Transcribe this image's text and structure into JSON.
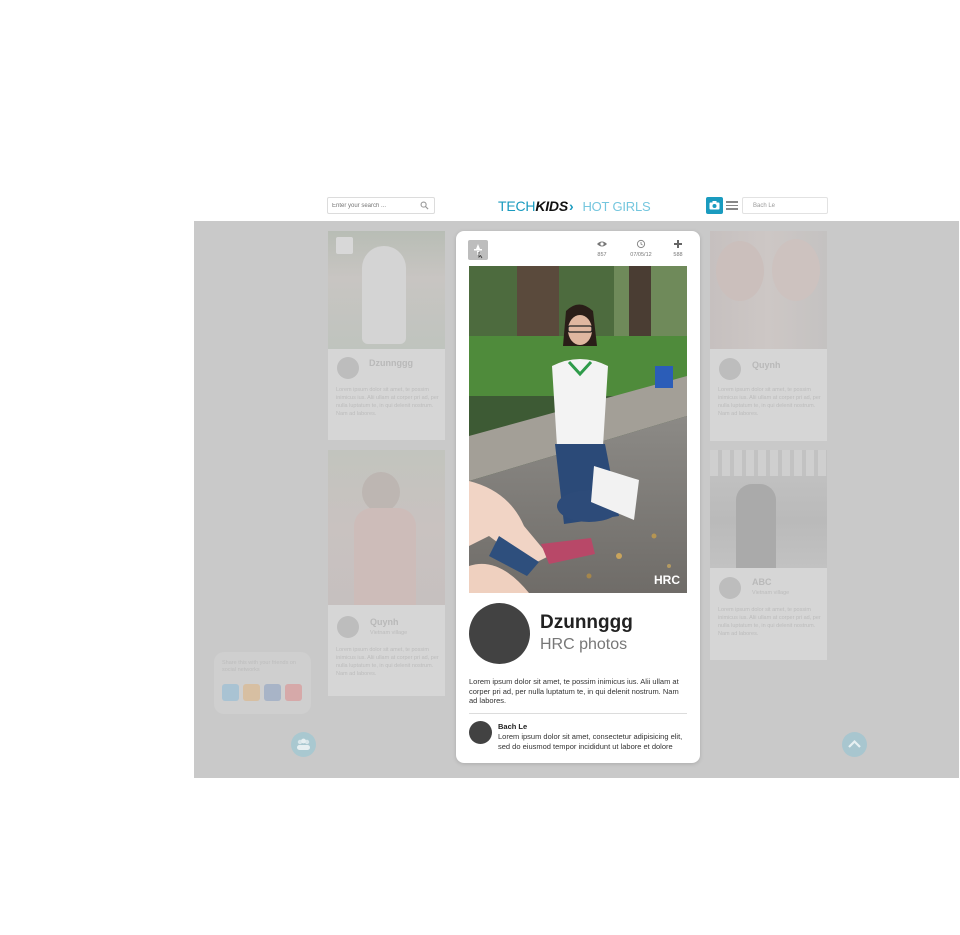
{
  "header": {
    "search_placeholder": "Enter your search ...",
    "logo": {
      "tech": "TECH",
      "kids": "KIDS",
      "chevron": "›",
      "hot": "HOT GIRLS"
    },
    "username": "Bach Le"
  },
  "background_cards": {
    "left": [
      {
        "name": "Dzunnggg",
        "text": "Lorem ipsum dolor sit amet, te possim inimicus ius. Alii ullam at corper pri ad, per nulla luptatum te, in qui delenit nostrum. Nam ad labores."
      },
      {
        "name": "Quynh",
        "sub": "Vietnam village",
        "text": "Lorem ipsum dolor sit amet, te possim inimicus ius. Alii ullam at corper pri ad, per nulla luptatum te, in qui delenit nostrum. Nam ad labores."
      }
    ],
    "right": [
      {
        "name": "Quynh",
        "text": "Lorem ipsum dolor sit amet, te possim inimicus ius. Alii ullam at corper pri ad, per nulla luptatum te, in qui delenit nostrum. Nam ad labores."
      },
      {
        "name": "ABC",
        "sub": "Vietnam village",
        "text": "Lorem ipsum dolor sit amet, te possim inimicus ius. Alii ullam at corper pri ad, per nulla luptatum te, in qui delenit nostrum. Nam ad labores."
      }
    ]
  },
  "share_bubble_text": "Share this with your friends on social networks",
  "modal": {
    "stats": [
      {
        "icon": "eye-icon",
        "value": "857"
      },
      {
        "icon": "clock-icon",
        "value": "07/05/12"
      },
      {
        "icon": "plus-icon",
        "value": "588"
      }
    ],
    "watermark": "HRC",
    "poster": {
      "name": "Dzunnggg",
      "subtitle": "HRC photos"
    },
    "description": "Lorem ipsum dolor sit amet, te possim inimicus ius. Alii ullam at corper pri ad, per nulla luptatum te, in qui delenit nostrum. Nam ad labores.",
    "comment": {
      "author": "Bach Le",
      "text": "Lorem ipsum dolor sit amet, consectetur adipisicing elit, sed do eiusmod tempor incididunt ut labore et dolore"
    }
  },
  "colors": {
    "accent": "#1a9bbf",
    "overlay": "#c9c9c9",
    "avatar": "#424242"
  }
}
